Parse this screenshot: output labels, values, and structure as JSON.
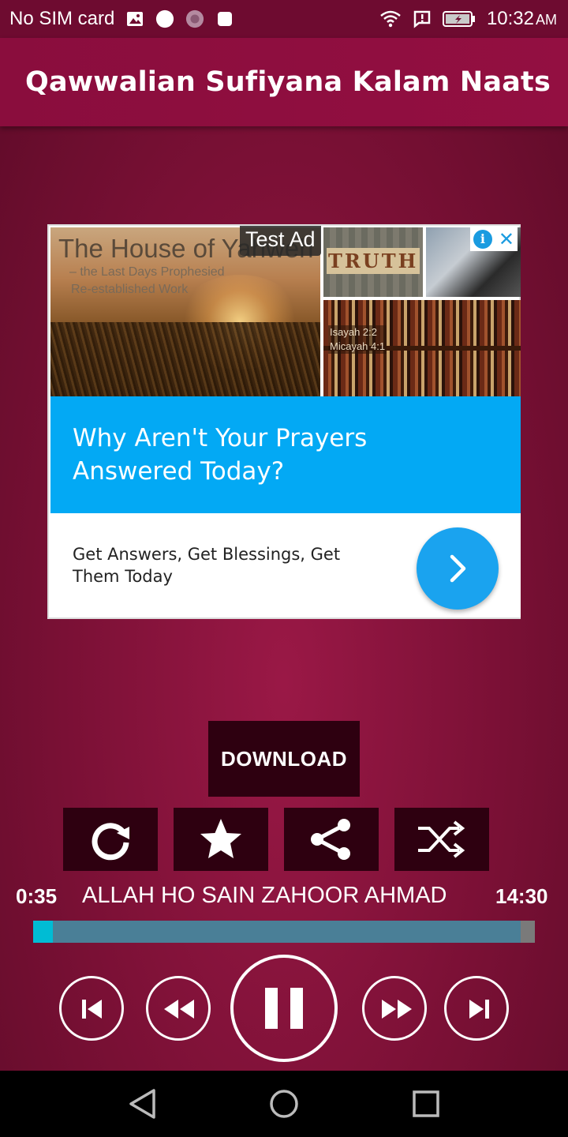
{
  "status_bar": {
    "carrier": "No SIM card",
    "time": "10:32",
    "ampm": "AM"
  },
  "app_bar": {
    "title": "Qawwalian Sufiyana Kalam Naats"
  },
  "ad": {
    "badge": "Test Ad",
    "image_headline": "The House of Yahweh",
    "image_sub1": "– the Last Days Prophesied",
    "image_sub2": "Re-established Work",
    "truth_text": "TRUTH",
    "books_caption1": "Isayah 2:2",
    "books_caption2": "Micayah 4:1",
    "headline": "Why Aren't Your Prayers Answered Today?",
    "body": "Get Answers, Get Blessings, Get Them Today",
    "colors": {
      "headline_bg": "#03a9f4",
      "cta": "#1aa3ef"
    }
  },
  "player": {
    "download_label": "DOWNLOAD",
    "controls": [
      "repeat-icon",
      "favorite-star-icon",
      "share-icon",
      "shuffle-icon"
    ],
    "elapsed": "0:35",
    "duration": "14:30",
    "song_title": "ALLAH HO SAIN ZAHOOR AHMAD",
    "progress_fraction": 0.04,
    "transport": [
      "skip-previous-icon",
      "rewind-icon",
      "pause-icon",
      "fast-forward-icon",
      "skip-next-icon"
    ],
    "colors": {
      "progress_played": "#00bcd4",
      "progress_track": "#4a7f97",
      "button_bg": "#2e0010"
    }
  },
  "nav_bar": {
    "buttons": [
      "back-icon",
      "home-icon",
      "recents-icon"
    ]
  }
}
